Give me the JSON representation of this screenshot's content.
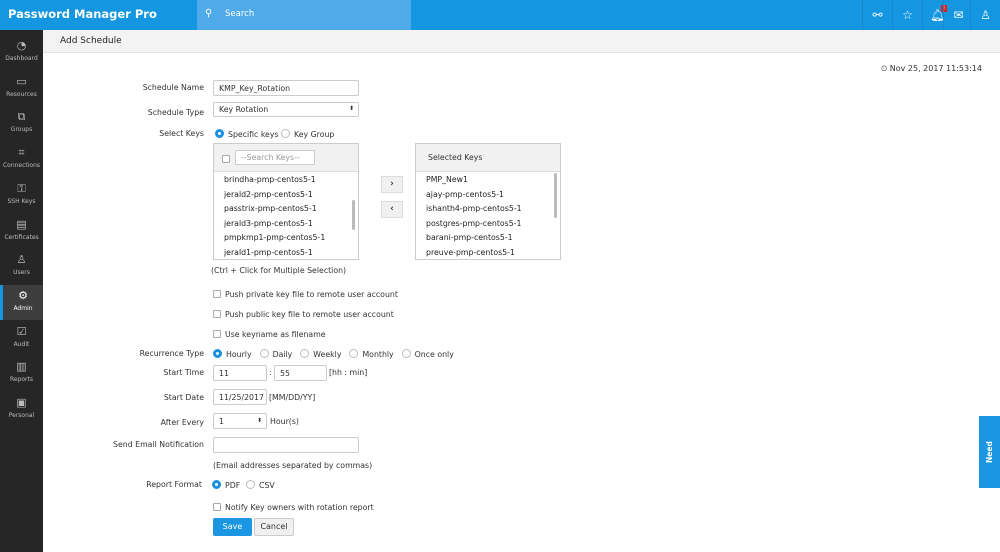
{
  "app": {
    "title": "Password Manager Pro",
    "search_placeholder": "Search"
  },
  "topbar_icons": [
    "link-icon",
    "user-star-icon",
    "bell-icon",
    "mail-icon",
    "user-icon"
  ],
  "notification_badge": "!",
  "sidebar": {
    "items": [
      {
        "label": "Dashboard",
        "icon": "◔"
      },
      {
        "label": "Resources",
        "icon": "▭"
      },
      {
        "label": "Groups",
        "icon": "⧉"
      },
      {
        "label": "Connections",
        "icon": "⌗"
      },
      {
        "label": "SSH Keys",
        "icon": "⚿"
      },
      {
        "label": "Certificates",
        "icon": "▤"
      },
      {
        "label": "Users",
        "icon": "♙"
      },
      {
        "label": "Admin",
        "icon": "⚙"
      },
      {
        "label": "Audit",
        "icon": "☑"
      },
      {
        "label": "Reports",
        "icon": "▥"
      },
      {
        "label": "Personal",
        "icon": "▣"
      }
    ],
    "active": "Admin"
  },
  "page": {
    "title": "Add Schedule",
    "datetime": "Nov 25, 2017 11:53:14"
  },
  "form": {
    "schedule_name_label": "Schedule Name",
    "schedule_name": "KMP_Key_Rotation",
    "schedule_type_label": "Schedule Type",
    "schedule_type": "Key Rotation",
    "select_keys_label": "Select Keys",
    "specific_keys": "Specific keys",
    "key_group": "Key Group",
    "search_keys_placeholder": "--Search Keys--",
    "available_keys": [
      "brindha-pmp-centos5-1",
      "jerald2-pmp-centos5-1",
      "passtrix-pmp-centos5-1",
      "jerald3-pmp-centos5-1",
      "pmpkmp1-pmp-centos5-1",
      "jerald1-pmp-centos5-1"
    ],
    "selected_keys_header": "Selected Keys",
    "selected_keys": [
      "PMP_New1",
      "ajay-pmp-centos5-1",
      "ishanth4-pmp-centos5-1",
      "postgres-pmp-centos5-1",
      "barani-pmp-centos5-1",
      "preuve-pmp-centos5-1"
    ],
    "move_right": "›",
    "move_left": "‹",
    "multi_select_hint": "(Ctrl + Click for Multiple Selection)",
    "push_private": "Push private key file to remote user account",
    "push_public": "Push public key file to remote user account",
    "use_keyname": "Use keyname as filename",
    "recurrence_label": "Recurrence Type",
    "recurrence_options": [
      "Hourly",
      "Daily",
      "Weekly",
      "Monthly",
      "Once only"
    ],
    "recurrence_selected": "Hourly",
    "start_time_label": "Start Time",
    "start_hour": "11",
    "time_sep": ":",
    "start_min": "55",
    "time_format": "[hh : min]",
    "start_date_label": "Start Date",
    "start_date": "11/25/2017",
    "date_format": "[MM/DD/YY]",
    "after_every_label": "After Every",
    "after_every": "1",
    "after_every_unit": "Hour(s)",
    "email_label": "Send Email Notification",
    "email_value": "",
    "email_hint": "(Email addresses separated by commas)",
    "report_format_label": "Report Format",
    "report_pdf": "PDF",
    "report_csv": "CSV",
    "notify_owners": "Notify Key owners with rotation report",
    "save": "Save",
    "cancel": "Cancel"
  },
  "assist": "Need Assistance?"
}
